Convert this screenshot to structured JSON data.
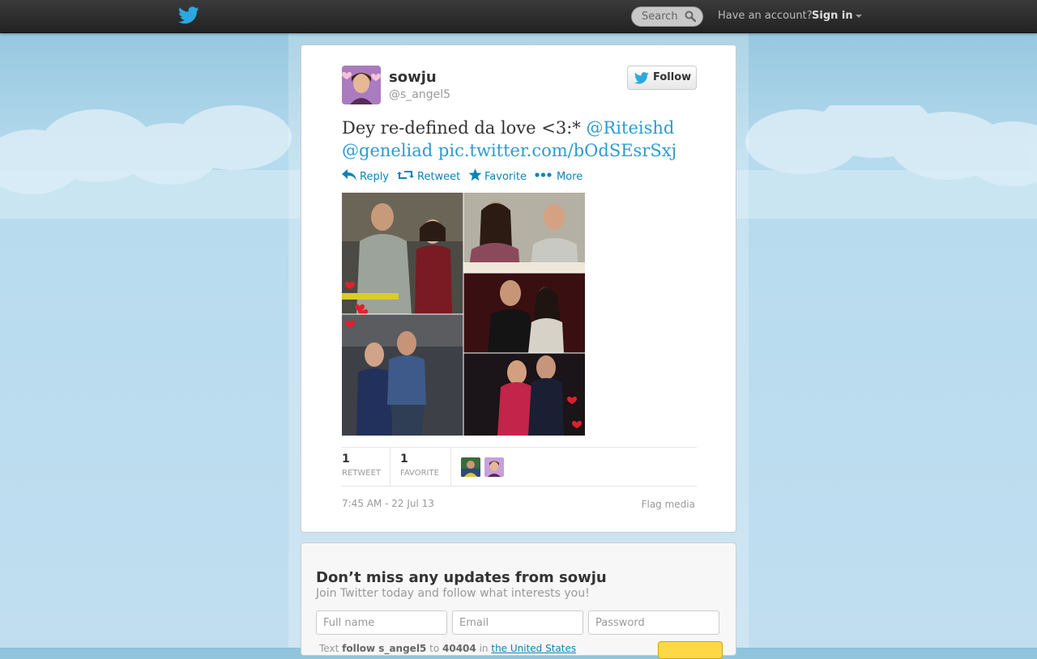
{
  "topbar": {
    "search_placeholder": "Search",
    "have_account": "Have an account?",
    "sign_in": "Sign in"
  },
  "tweet": {
    "user_name": "sowju",
    "user_handle": "@s_angel5",
    "follow_label": "Follow",
    "text_before": "Dey re-defined da love <3:* ",
    "mention_1": "@Riteishd",
    "mention_2": "@geneliad",
    "pic_link": "pic.twitter.com/bOdSEsrSxj",
    "actions": {
      "reply": "Reply",
      "retweet": "Retweet",
      "favorite": "Favorite",
      "more": "More"
    },
    "stats": {
      "retweet_count": "1",
      "retweet_label": "RETWEET",
      "favorite_count": "1",
      "favorite_label": "FAVORITE"
    },
    "timestamp": "7:45 AM - 22 Jul 13",
    "flag_media": "Flag media"
  },
  "signup": {
    "title": "Don’t miss any updates from sowju",
    "subtitle": "Join Twitter today and follow what interests you!",
    "fullname_placeholder": "Full name",
    "email_placeholder": "Email",
    "password_placeholder": "Password",
    "sms_text": "Text",
    "sms_command": "follow s_angel5",
    "sms_to": "to",
    "sms_number": "40404",
    "sms_in": "in",
    "sms_country": "the United States"
  },
  "colors": {
    "link": "#2b9bd2",
    "action": "#0a84b4",
    "twitter_blue": "#2aa9e0",
    "sky": "#b7dbee"
  }
}
